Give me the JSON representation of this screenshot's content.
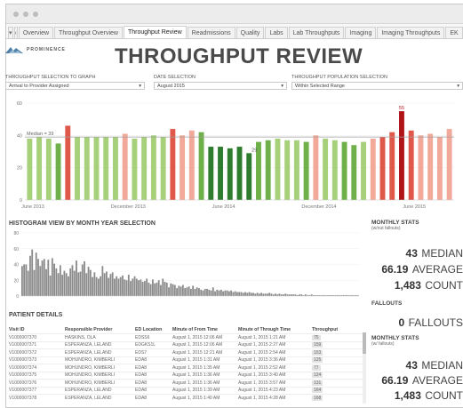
{
  "window": {
    "dots": [
      "close",
      "minimize",
      "maximize"
    ]
  },
  "tabs": [
    {
      "label": "Overview",
      "active": false
    },
    {
      "label": "Throughput Overview",
      "active": false
    },
    {
      "label": "Throughput Review",
      "active": true
    },
    {
      "label": "Readmissions",
      "active": false
    },
    {
      "label": "Quality",
      "active": false
    },
    {
      "label": "Labs",
      "active": false
    },
    {
      "label": "Lab Throughputs",
      "active": false
    },
    {
      "label": "Imaging",
      "active": false
    },
    {
      "label": "Imaging Throughputs",
      "active": false
    },
    {
      "label": "EK",
      "active": false
    }
  ],
  "nav": {
    "menu": "▾",
    "back": "‹"
  },
  "header": {
    "logo_text": "PROMINENCE",
    "title": "THROUGHPUT REVIEW"
  },
  "filters": [
    {
      "label": "Throughput selection to graph",
      "value": "Arrival to Provider Assigned"
    },
    {
      "label": "Date selection",
      "value": "August 2015"
    },
    {
      "label": "Throughput population selection",
      "value": "Within Selected Range"
    }
  ],
  "colors": {
    "green_light": "#a6d07a",
    "green_mid": "#6fb04a",
    "green_dark": "#2e7d2e",
    "red_light": "#f2a99a",
    "red_mid": "#e0584a",
    "red_dark": "#b0151a",
    "median_line": "#9e9e9e"
  },
  "chart_data": [
    {
      "type": "bar",
      "title": "",
      "ylim": [
        0,
        60
      ],
      "yticks": [
        0,
        20,
        40,
        60
      ],
      "xticks": [
        "June 2013",
        "December 2013",
        "June 2014",
        "December 2014",
        "June 2015"
      ],
      "values": [
        38,
        39,
        38,
        35,
        46,
        39,
        39,
        39,
        39,
        39,
        41,
        38,
        39,
        40,
        39,
        44,
        40,
        43,
        42,
        33,
        33,
        32,
        33,
        29,
        36,
        37,
        38,
        37,
        37,
        36,
        40,
        38,
        37,
        36,
        34,
        36,
        38,
        39,
        42,
        55,
        43,
        40,
        41,
        39,
        44
      ],
      "bar_colors": [
        "gl",
        "gl",
        "gl",
        "gm",
        "rm",
        "gl",
        "gl",
        "gl",
        "gl",
        "gl",
        "rl",
        "gl",
        "gl",
        "gl",
        "gl",
        "rm",
        "rl",
        "rl",
        "gm",
        "gd",
        "gd",
        "gd",
        "gd",
        "gd",
        "gm",
        "gm",
        "gl",
        "gl",
        "gl",
        "gm",
        "rl",
        "gl",
        "gl",
        "gm",
        "gm",
        "gl",
        "rl",
        "rm",
        "rm",
        "rd",
        "rm",
        "rl",
        "rl",
        "rl",
        "rl"
      ],
      "median": {
        "label": "Median = 39",
        "value": 39
      },
      "data_labels": [
        {
          "index": 23,
          "text": "29"
        },
        {
          "index": 39,
          "text": "55"
        }
      ]
    },
    {
      "type": "bar",
      "title": "HISTOGRAM VIEW BY MONTH YEAR SELECTION",
      "ylim": [
        0,
        80
      ],
      "yticks": [
        0,
        20,
        40,
        60,
        80
      ],
      "values": [
        38,
        40,
        40,
        32,
        51,
        59,
        33,
        55,
        47,
        38,
        45,
        47,
        34,
        46,
        26,
        48,
        41,
        35,
        29,
        39,
        27,
        32,
        29,
        25,
        35,
        39,
        32,
        45,
        30,
        31,
        40,
        44,
        29,
        37,
        33,
        24,
        30,
        24,
        22,
        25,
        38,
        29,
        31,
        23,
        28,
        30,
        22,
        25,
        22,
        24,
        26,
        21,
        20,
        27,
        19,
        22,
        25,
        22,
        20,
        21,
        18,
        19,
        22,
        17,
        15,
        21,
        16,
        17,
        20,
        14,
        22,
        18,
        17,
        11,
        16,
        15,
        14,
        10,
        13,
        12,
        14,
        10,
        11,
        12,
        9,
        13,
        9,
        11,
        10,
        8,
        7,
        9,
        9,
        8,
        7,
        11,
        6,
        8,
        7,
        8,
        6,
        7,
        7,
        6,
        7,
        5,
        6,
        5,
        5,
        5,
        4,
        5,
        4,
        5,
        4,
        4,
        3,
        4,
        3,
        4,
        3,
        3,
        3,
        4,
        3,
        2,
        3,
        2,
        3,
        2,
        2,
        3,
        2,
        2,
        2,
        2,
        2,
        1,
        2,
        2,
        1,
        2,
        1,
        1,
        2,
        1,
        1,
        1,
        1,
        1,
        1,
        1,
        1,
        1,
        1,
        1,
        1,
        1,
        1,
        1,
        1,
        1,
        1,
        1,
        1,
        1,
        1,
        1
      ]
    }
  ],
  "monthly_stats": {
    "title": "MONTHLY STATS",
    "subtitle": "(w/out fallouts)",
    "median_value": "43",
    "median_label": "MEDIAN",
    "average_value": "66.19",
    "average_label": "AVERAGE",
    "count_value": "1,483",
    "count_label": "COUNT"
  },
  "fallouts": {
    "title": "FALLOUTS",
    "value": "0",
    "label": "FALLOUTS"
  },
  "monthly_stats_with": {
    "title": "MONTHLY STATS",
    "subtitle": "(w/ fallouts)",
    "median_value": "43",
    "median_label": "MEDIAN",
    "average_value": "66.19",
    "average_label": "AVERAGE",
    "count_value": "1,483",
    "count_label": "COUNT"
  },
  "patient_details": {
    "title": "PATIENT DETAILS",
    "columns": [
      "Visit ID",
      "Responsible Provider",
      "ED Location",
      "Minute of From Time",
      "Minute of Through Time",
      "Throughput"
    ],
    "rows": [
      [
        "V1000007370",
        "HASKINS, OLA",
        "EDSS6",
        "August 1, 2015 12:06 AM",
        "August 1, 2015 1:21 AM",
        "75"
      ],
      [
        "V1000007371",
        "ESPERANZA, LELAND",
        "EDGKS1L",
        "August 1, 2015 12:06 AM",
        "August 1, 2015 2:27 AM",
        "159"
      ],
      [
        "V1000007372",
        "ESPERANZA, LELAND",
        "EDS7",
        "August 1, 2015 12:21 AM",
        "August 1, 2015 2:54 AM",
        "153"
      ],
      [
        "V1000007373",
        "MOHUNDRO, KIMBERLI",
        "EDA8",
        "August 1, 2015 1:31 AM",
        "August 1, 2015 3:36 AM",
        "125"
      ],
      [
        "V1000007374",
        "MOHUNDRO, KIMBERLI",
        "EDA8",
        "August 1, 2015 1:35 AM",
        "August 1, 2015 2:52 AM",
        "77"
      ],
      [
        "V1000007375",
        "MOHUNDRO, KIMBERLI",
        "EDA8",
        "August 1, 2015 1:36 AM",
        "August 1, 2015 3:40 AM",
        "124"
      ],
      [
        "V1000007376",
        "MOHUNDRO, KIMBERLI",
        "EDA8",
        "August 1, 2015 1:36 AM",
        "August 1, 2015 3:57 AM",
        "131"
      ],
      [
        "V1000007377",
        "ESPERANZA, LELAND",
        "EDA8",
        "August 1, 2015 1:39 AM",
        "August 1, 2015 4:23 AM",
        "164"
      ],
      [
        "V1000007378",
        "ESPERANZA, LELAND",
        "EDA8",
        "August 1, 2015 1:40 AM",
        "August 1, 2015 4:28 AM",
        "168"
      ]
    ]
  }
}
